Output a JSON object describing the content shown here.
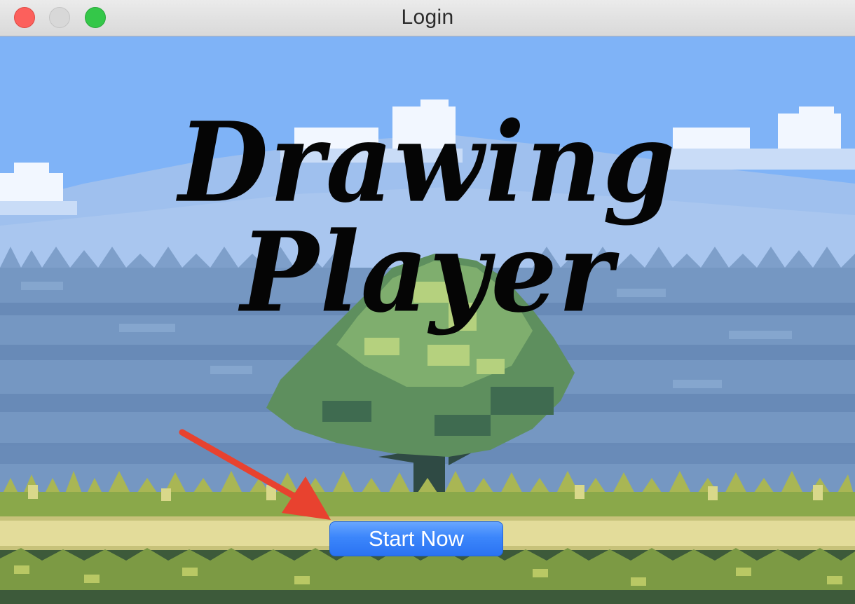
{
  "window": {
    "title": "Login"
  },
  "scene": {
    "heading": "Drawing Player",
    "start_button_label": "Start Now"
  },
  "colors": {
    "sky": "#7fb3f7",
    "mountain": "#9fc0ee",
    "forest": "#6f93bd",
    "tree_canopy": "#7fae6e",
    "grass": "#8aa84a",
    "path": "#e3dc9a",
    "button": "#3c86fb",
    "arrow": "#e8422f"
  },
  "icons": [
    "close-icon",
    "minimize-icon",
    "maximize-icon",
    "arrow-icon"
  ]
}
